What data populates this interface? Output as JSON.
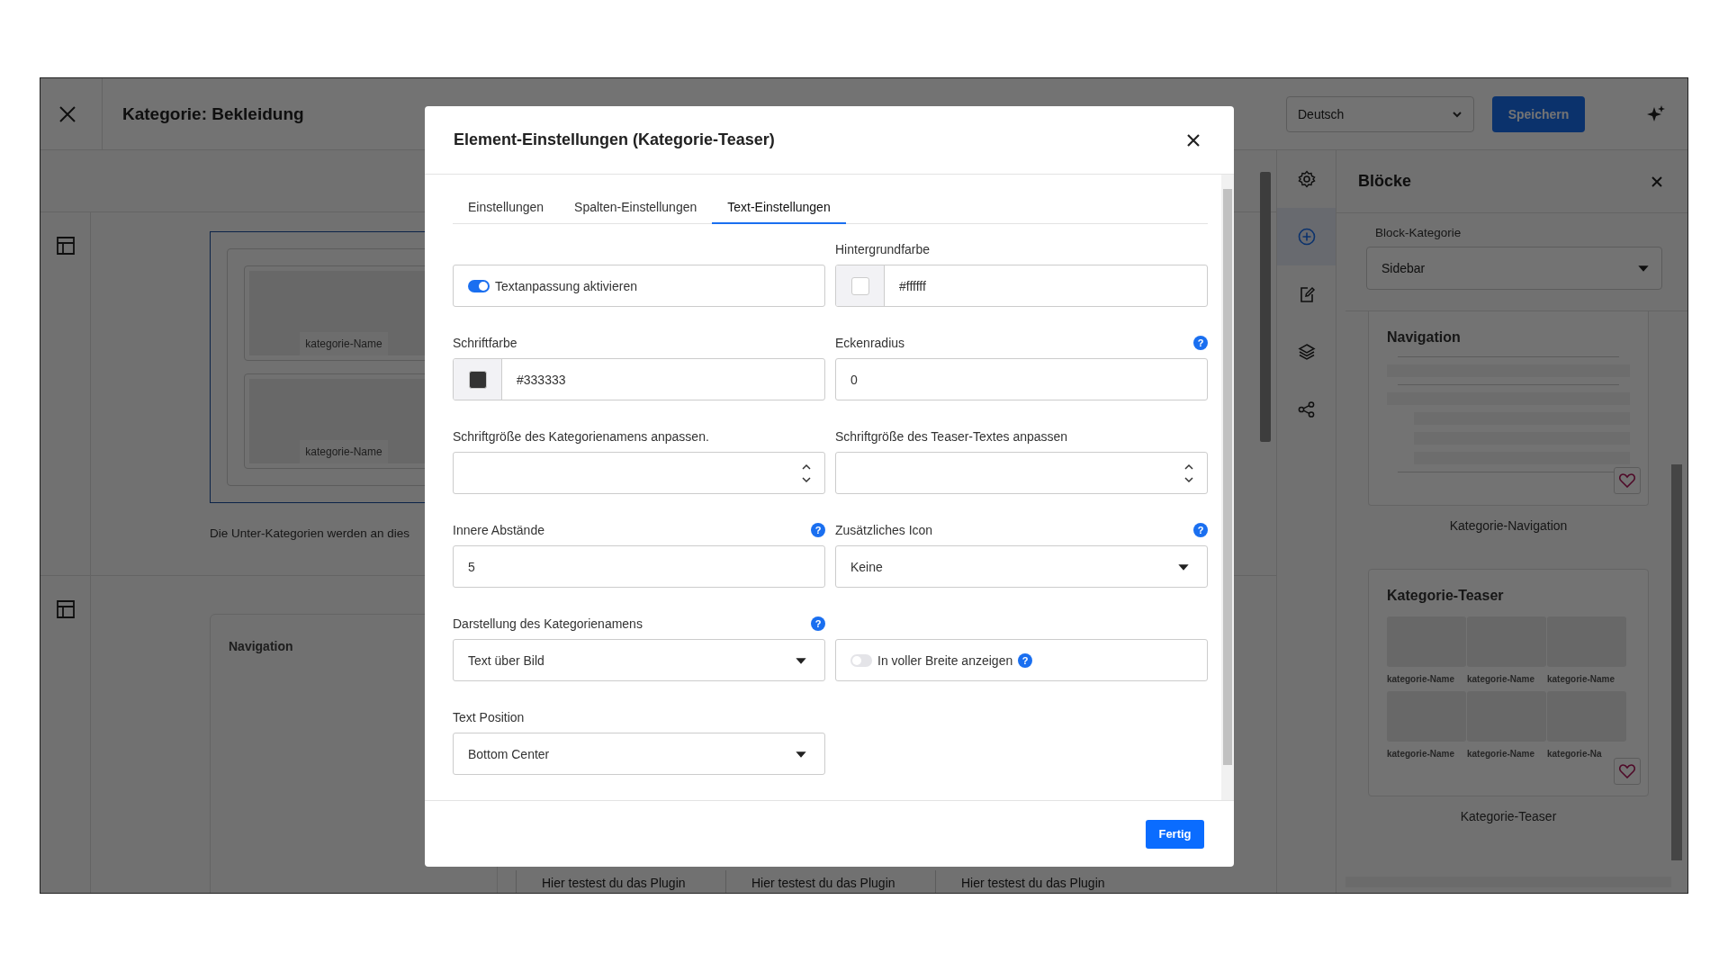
{
  "topbar": {
    "title": "Kategorie: Bekleidung",
    "language": "Deutsch",
    "save": "Speichern"
  },
  "canvas": {
    "teaser_tiles": [
      "kategorie-Name",
      "kategorie-Name"
    ],
    "teaser_note": "Die Unter-Kategorien werden an dies",
    "navigation_heading": "Navigation",
    "plugin_cells": [
      "Hier testest du das Plugin",
      "Hier testest du das Plugin",
      "Hier testest du das Plugin"
    ]
  },
  "rail": [
    {
      "kind": "settings",
      "selected": false
    },
    {
      "kind": "add",
      "selected": true
    },
    {
      "kind": "edit",
      "selected": false
    },
    {
      "kind": "layers",
      "selected": false
    },
    {
      "kind": "share",
      "selected": false
    }
  ],
  "blocks_panel": {
    "title": "Blöcke",
    "category_label": "Block-Kategorie",
    "category": "Sidebar",
    "blocks": [
      {
        "kind": "navigation",
        "heading": "Navigation",
        "caption": "Kategorie-Navigation"
      },
      {
        "kind": "teaser",
        "heading": "Kategorie-Teaser",
        "tiles": [
          "kategorie-Name",
          "kategorie-Name",
          "kategorie-Name",
          "kategorie-Name",
          "kategorie-Name",
          "kategorie-Na"
        ],
        "caption": "Kategorie-Teaser"
      }
    ]
  },
  "modal": {
    "title": "Element-Einstellungen (Kategorie-Teaser)",
    "tabs": [
      {
        "label": "Einstellungen",
        "selected": false
      },
      {
        "label": "Spalten-Einstellungen",
        "selected": false
      },
      {
        "label": "Text-Einstellungen",
        "selected": true
      }
    ],
    "fields": [
      {
        "kind": "toggle",
        "text": "Textanpassung aktivieren",
        "on": true
      },
      {
        "kind": "color",
        "label": "Hintergrundfarbe",
        "value": "#ffffff",
        "color": "#ffffff"
      },
      {
        "kind": "color",
        "label": "Schriftfarbe",
        "value": "#333333",
        "color": "#333333"
      },
      {
        "kind": "text",
        "label": "Eckenradius",
        "value": "0",
        "help": "?"
      },
      {
        "kind": "number",
        "label": "Schriftgröße des Kategorienamens anpassen."
      },
      {
        "kind": "number",
        "label": "Schriftgröße des Teaser-Textes anpassen"
      },
      {
        "kind": "text",
        "label": "Innere Abstände",
        "value": "5",
        "help": "?"
      },
      {
        "kind": "select",
        "label": "Zusätzliches Icon",
        "value": "Keine",
        "help": "?"
      },
      {
        "kind": "select",
        "label": "Darstellung des Kategorienamens",
        "value": "Text über Bild",
        "help": "?"
      },
      {
        "kind": "toggle",
        "text": "In voller Breite anzeigen",
        "on": false,
        "help": "?"
      },
      {
        "kind": "select",
        "label": "Text Position",
        "value": "Bottom Center"
      }
    ],
    "done": "Fertig"
  }
}
